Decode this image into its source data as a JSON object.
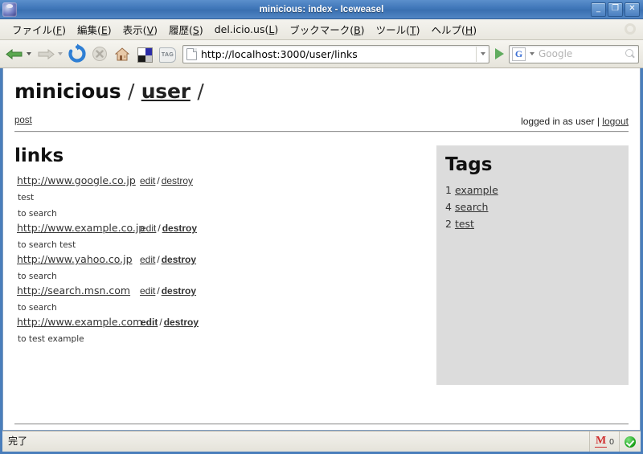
{
  "window": {
    "title": "minicious: index - Iceweasel",
    "icon": "iceweasel-icon",
    "controls": [
      {
        "name": "minimize-button",
        "glyph": "_"
      },
      {
        "name": "maximize-button",
        "glyph": "❐"
      },
      {
        "name": "close-button",
        "glyph": "✕"
      }
    ]
  },
  "menubar": {
    "items": [
      {
        "name": "menu-file",
        "label": "ファイル(",
        "accel": "F",
        "tail": ")"
      },
      {
        "name": "menu-edit",
        "label": "編集(",
        "accel": "E",
        "tail": ")"
      },
      {
        "name": "menu-view",
        "label": "表示(",
        "accel": "V",
        "tail": ")"
      },
      {
        "name": "menu-history",
        "label": "履歴(",
        "accel": "S",
        "tail": ")"
      },
      {
        "name": "menu-delicious",
        "label": "del.icio.us(",
        "accel": "L",
        "tail": ")"
      },
      {
        "name": "menu-bookmarks",
        "label": "ブックマーク(",
        "accel": "B",
        "tail": ")"
      },
      {
        "name": "menu-tools",
        "label": "ツール(",
        "accel": "T",
        "tail": ")"
      },
      {
        "name": "menu-help",
        "label": "ヘルプ(",
        "accel": "H",
        "tail": ")"
      }
    ],
    "throbber": "throbber-icon"
  },
  "toolbar": {
    "back": "back-arrow-icon",
    "forward": "forward-arrow-icon",
    "reload": "reload-icon",
    "stop": "stop-icon",
    "home": "home-icon",
    "squares": "four-squares-icon",
    "tag": "TAG",
    "url_value": "http://localhost:3000/user/links",
    "go": "go-arrow-icon",
    "search_engine": "G",
    "search_placeholder": "Google",
    "search_value": ""
  },
  "page": {
    "brand": "minicious",
    "breadcrumb_sep1": "/",
    "breadcrumb_user": "user",
    "breadcrumb_sep2": "/",
    "post_label": "post",
    "logged_in_text": "logged in as user",
    "pipe": "|",
    "logout_label": "logout",
    "links_heading": "links",
    "links": [
      {
        "url": "http://www.google.co.jp",
        "edit": "edit",
        "slash": "/",
        "destroy": "destroy",
        "edit_bold": false,
        "destroy_bold": false,
        "url_width": 146,
        "meta": [
          "test",
          "to search"
        ]
      },
      {
        "url": "http://www.example.co.jp",
        "edit": "edit",
        "slash": "/",
        "destroy": "destroy",
        "edit_bold": false,
        "destroy_bold": true,
        "url_width": 152,
        "meta": [
          "to search test"
        ]
      },
      {
        "url": "http://www.yahoo.co.jp",
        "edit": "edit",
        "slash": "/",
        "destroy": "destroy",
        "edit_bold": false,
        "destroy_bold": true,
        "url_width": 146,
        "meta": [
          "to search"
        ]
      },
      {
        "url": "http://search.msn.com",
        "edit": "edit",
        "slash": "/",
        "destroy": "destroy",
        "edit_bold": false,
        "destroy_bold": true,
        "url_width": 146,
        "meta": [
          "to search"
        ]
      },
      {
        "url": "http://www.example.com",
        "edit": "edit",
        "slash": "/",
        "destroy": "destroy",
        "edit_bold": true,
        "destroy_bold": true,
        "url_width": 152,
        "meta": [
          "to test example"
        ]
      }
    ],
    "tags_heading": "Tags",
    "tags": [
      {
        "count": "1",
        "label": "example"
      },
      {
        "count": "4",
        "label": "search"
      },
      {
        "count": "2",
        "label": "test"
      }
    ]
  },
  "statusbar": {
    "text": "完了",
    "mail_icon": "gmail-icon",
    "mail_glyph": "M",
    "mail_count": "0",
    "shield_icon": "security-shield-icon"
  },
  "colors": {
    "titlebar": "#3f76b8",
    "chrome": "#ece9e0",
    "sidebar_panel": "#dcdcdc",
    "page_bg": "#ffffff",
    "link": "#333333"
  }
}
